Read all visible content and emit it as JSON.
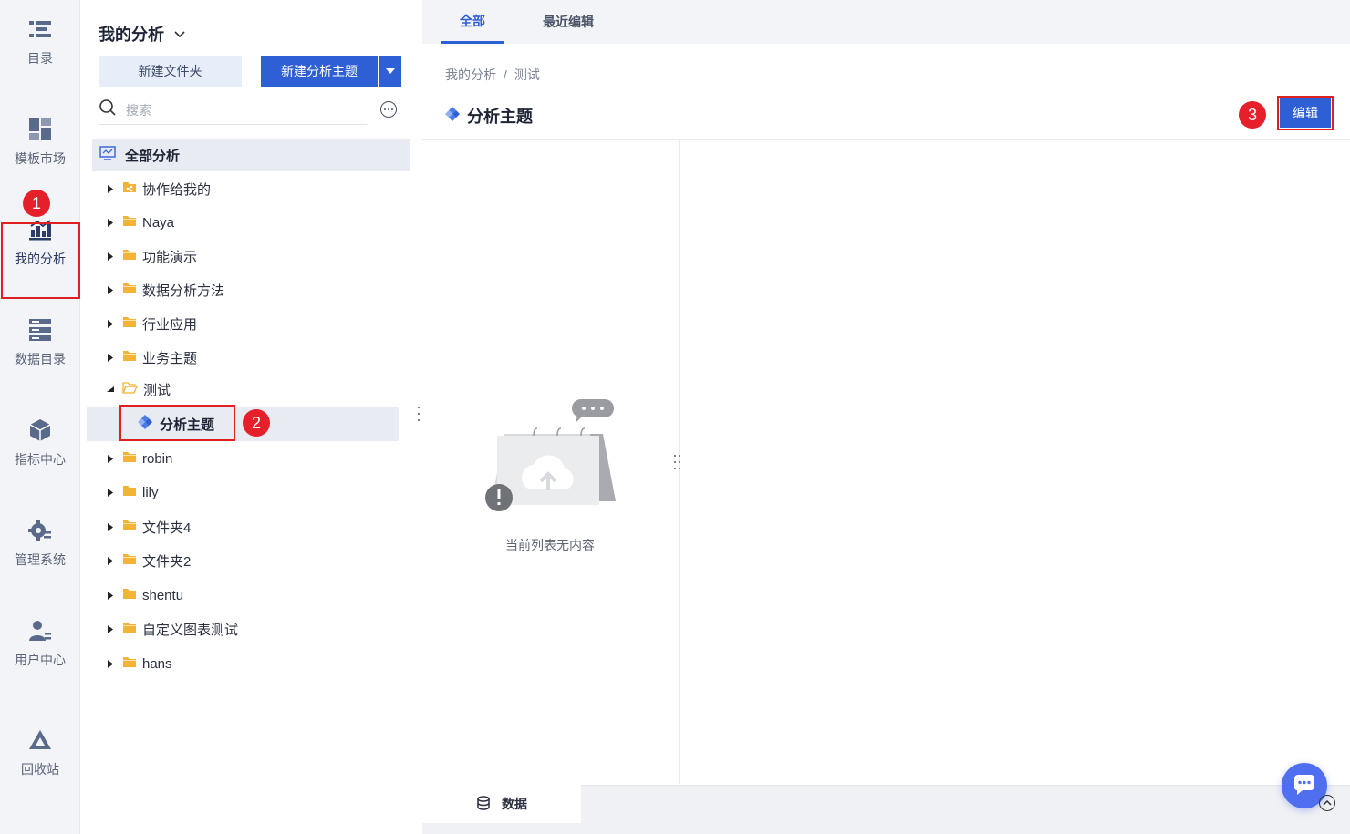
{
  "rail": {
    "items": [
      {
        "label": "目录",
        "icon": "catalog-icon"
      },
      {
        "label": "模板市场",
        "icon": "template-market-icon"
      },
      {
        "label": "我的分析",
        "icon": "my-analysis-icon"
      },
      {
        "label": "数据目录",
        "icon": "data-catalog-icon"
      },
      {
        "label": "指标中心",
        "icon": "metric-center-icon"
      },
      {
        "label": "管理系统",
        "icon": "admin-system-icon"
      },
      {
        "label": "用户中心",
        "icon": "user-center-icon"
      },
      {
        "label": "回收站",
        "icon": "recycle-bin-icon"
      }
    ]
  },
  "badges": {
    "one": "1",
    "two": "2",
    "three": "3"
  },
  "panel": {
    "title": "我的分析",
    "new_folder": "新建文件夹",
    "new_topic": "新建分析主题",
    "search_placeholder": "搜索",
    "root": "全部分析",
    "tree": [
      {
        "label": "协作给我的",
        "type": "shared-folder"
      },
      {
        "label": "Naya",
        "type": "folder"
      },
      {
        "label": "功能演示",
        "type": "folder"
      },
      {
        "label": "数据分析方法",
        "type": "folder"
      },
      {
        "label": "行业应用",
        "type": "folder"
      },
      {
        "label": "业务主题",
        "type": "folder"
      },
      {
        "label": "测试",
        "type": "folder-open"
      },
      {
        "label": "分析主题",
        "type": "topic"
      },
      {
        "label": "robin",
        "type": "folder"
      },
      {
        "label": "lily",
        "type": "folder"
      },
      {
        "label": "文件夹4",
        "type": "folder"
      },
      {
        "label": "文件夹2",
        "type": "folder"
      },
      {
        "label": "shentu",
        "type": "folder"
      },
      {
        "label": "自定义图表测试",
        "type": "folder"
      },
      {
        "label": "hans",
        "type": "folder"
      }
    ]
  },
  "main": {
    "tabs": [
      {
        "label": "全部"
      },
      {
        "label": "最近编辑"
      }
    ],
    "breadcrumb": {
      "parent": "我的分析",
      "sep": "/",
      "current": "测试"
    },
    "title": "分析主题",
    "edit": "编辑",
    "empty": "当前列表无内容",
    "data_tab": "数据"
  },
  "colors": {
    "accent": "#2e5fd5",
    "highlight": "#e02020",
    "folder": "#f5b335"
  }
}
